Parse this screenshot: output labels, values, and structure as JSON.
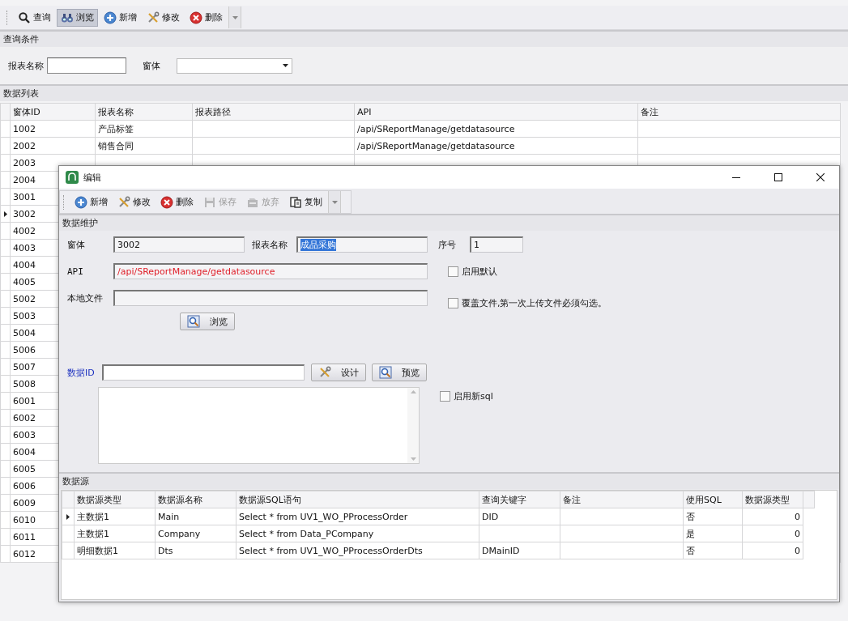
{
  "main_toolbar": [
    {
      "kind": "search",
      "label": "查询",
      "selected": false
    },
    {
      "kind": "binoculars",
      "label": "浏览",
      "selected": true
    },
    {
      "kind": "add",
      "label": "新增",
      "selected": false
    },
    {
      "kind": "edit",
      "label": "修改",
      "selected": false
    },
    {
      "kind": "delete",
      "label": "删除",
      "selected": false
    }
  ],
  "query_panel": {
    "title": "查询条件",
    "fields": [
      {
        "kind": "text",
        "label": "报表名称"
      },
      {
        "kind": "dropdown",
        "label": "窗体"
      }
    ]
  },
  "list_panel": {
    "title": "数据列表",
    "columns": [
      "窗体ID",
      "报表名称",
      "报表路径",
      "API",
      "备注"
    ],
    "rows": [
      {
        "id": "1002",
        "name": "产品标签",
        "api": "/api/SReportManage/getdatasource",
        "selected": false
      },
      {
        "id": "2002",
        "name": "销售合同",
        "api": "/api/SReportManage/getdatasource",
        "selected": false
      },
      {
        "id": "2003",
        "selected": false
      },
      {
        "id": "2004",
        "selected": false
      },
      {
        "id": "3001",
        "selected": false
      },
      {
        "id": "3002",
        "selected": true
      },
      {
        "id": "4002",
        "selected": false
      },
      {
        "id": "4003",
        "selected": false
      },
      {
        "id": "4004",
        "selected": false
      },
      {
        "id": "4005",
        "selected": false
      },
      {
        "id": "5002",
        "selected": false
      },
      {
        "id": "5003",
        "selected": false
      },
      {
        "id": "5004",
        "selected": false
      },
      {
        "id": "5006",
        "selected": false
      },
      {
        "id": "5007",
        "selected": false
      },
      {
        "id": "5008",
        "selected": false
      },
      {
        "id": "6001",
        "selected": false
      },
      {
        "id": "6002",
        "selected": false
      },
      {
        "id": "6003",
        "selected": false
      },
      {
        "id": "6004",
        "selected": false
      },
      {
        "id": "6005",
        "selected": false
      },
      {
        "id": "6006",
        "selected": false
      },
      {
        "id": "6009",
        "selected": false
      },
      {
        "id": "6010",
        "selected": false
      },
      {
        "id": "6011",
        "selected": false
      },
      {
        "id": "6012",
        "selected": false
      }
    ]
  },
  "dialog": {
    "title": "编辑",
    "toolbar": [
      {
        "kind": "add",
        "label": "新增",
        "disabled": false
      },
      {
        "kind": "edit",
        "label": "修改",
        "disabled": false
      },
      {
        "kind": "delete",
        "label": "删除",
        "disabled": false
      },
      {
        "kind": "save",
        "label": "保存",
        "disabled": true
      },
      {
        "kind": "discard",
        "label": "放弃",
        "disabled": true
      },
      {
        "kind": "copy",
        "label": "复制",
        "disabled": false
      }
    ],
    "section_title": "数据维护",
    "form": {
      "window_label": "窗体",
      "window_value": "3002",
      "report_name_label": "报表名称",
      "report_name_value": "成品采购",
      "seq_label": "序号",
      "seq_value": "1",
      "api_label": "API",
      "api_value": "/api/SReportManage/getdatasource",
      "local_file_label": "本地文件",
      "browse_button": "浏览",
      "data_id_label": "数据ID",
      "design_button": "设计",
      "preview_button": "预览"
    },
    "checkboxes": [
      {
        "label": "启用默认",
        "checked": false
      },
      {
        "label": "覆盖文件,第一次上传文件必须勾选。",
        "checked": false
      },
      {
        "label": "启用新sql",
        "checked": false
      }
    ],
    "datasource": {
      "title": "数据源",
      "columns": [
        "数据源类型",
        "数据源名称",
        "数据源SQL语句",
        "查询关键字",
        "备注",
        "使用SQL",
        "数据源类型"
      ],
      "rows": [
        {
          "type": "主数据1",
          "name": "Main",
          "sql": "Select * from UV1_WO_PProcessOrder",
          "key": "DID",
          "use_sql": "否",
          "source_type": "0",
          "selected": true
        },
        {
          "type": "主数据1",
          "name": "Company",
          "sql": "Select * from Data_PCompany",
          "use_sql": "是",
          "source_type": "0",
          "selected": false
        },
        {
          "type": "明细数据1",
          "name": "Dts",
          "sql": "Select * from UV1_WO_PProcessOrderDts",
          "key": "DMainID",
          "use_sql": "否",
          "source_type": "0",
          "selected": false
        }
      ]
    }
  }
}
